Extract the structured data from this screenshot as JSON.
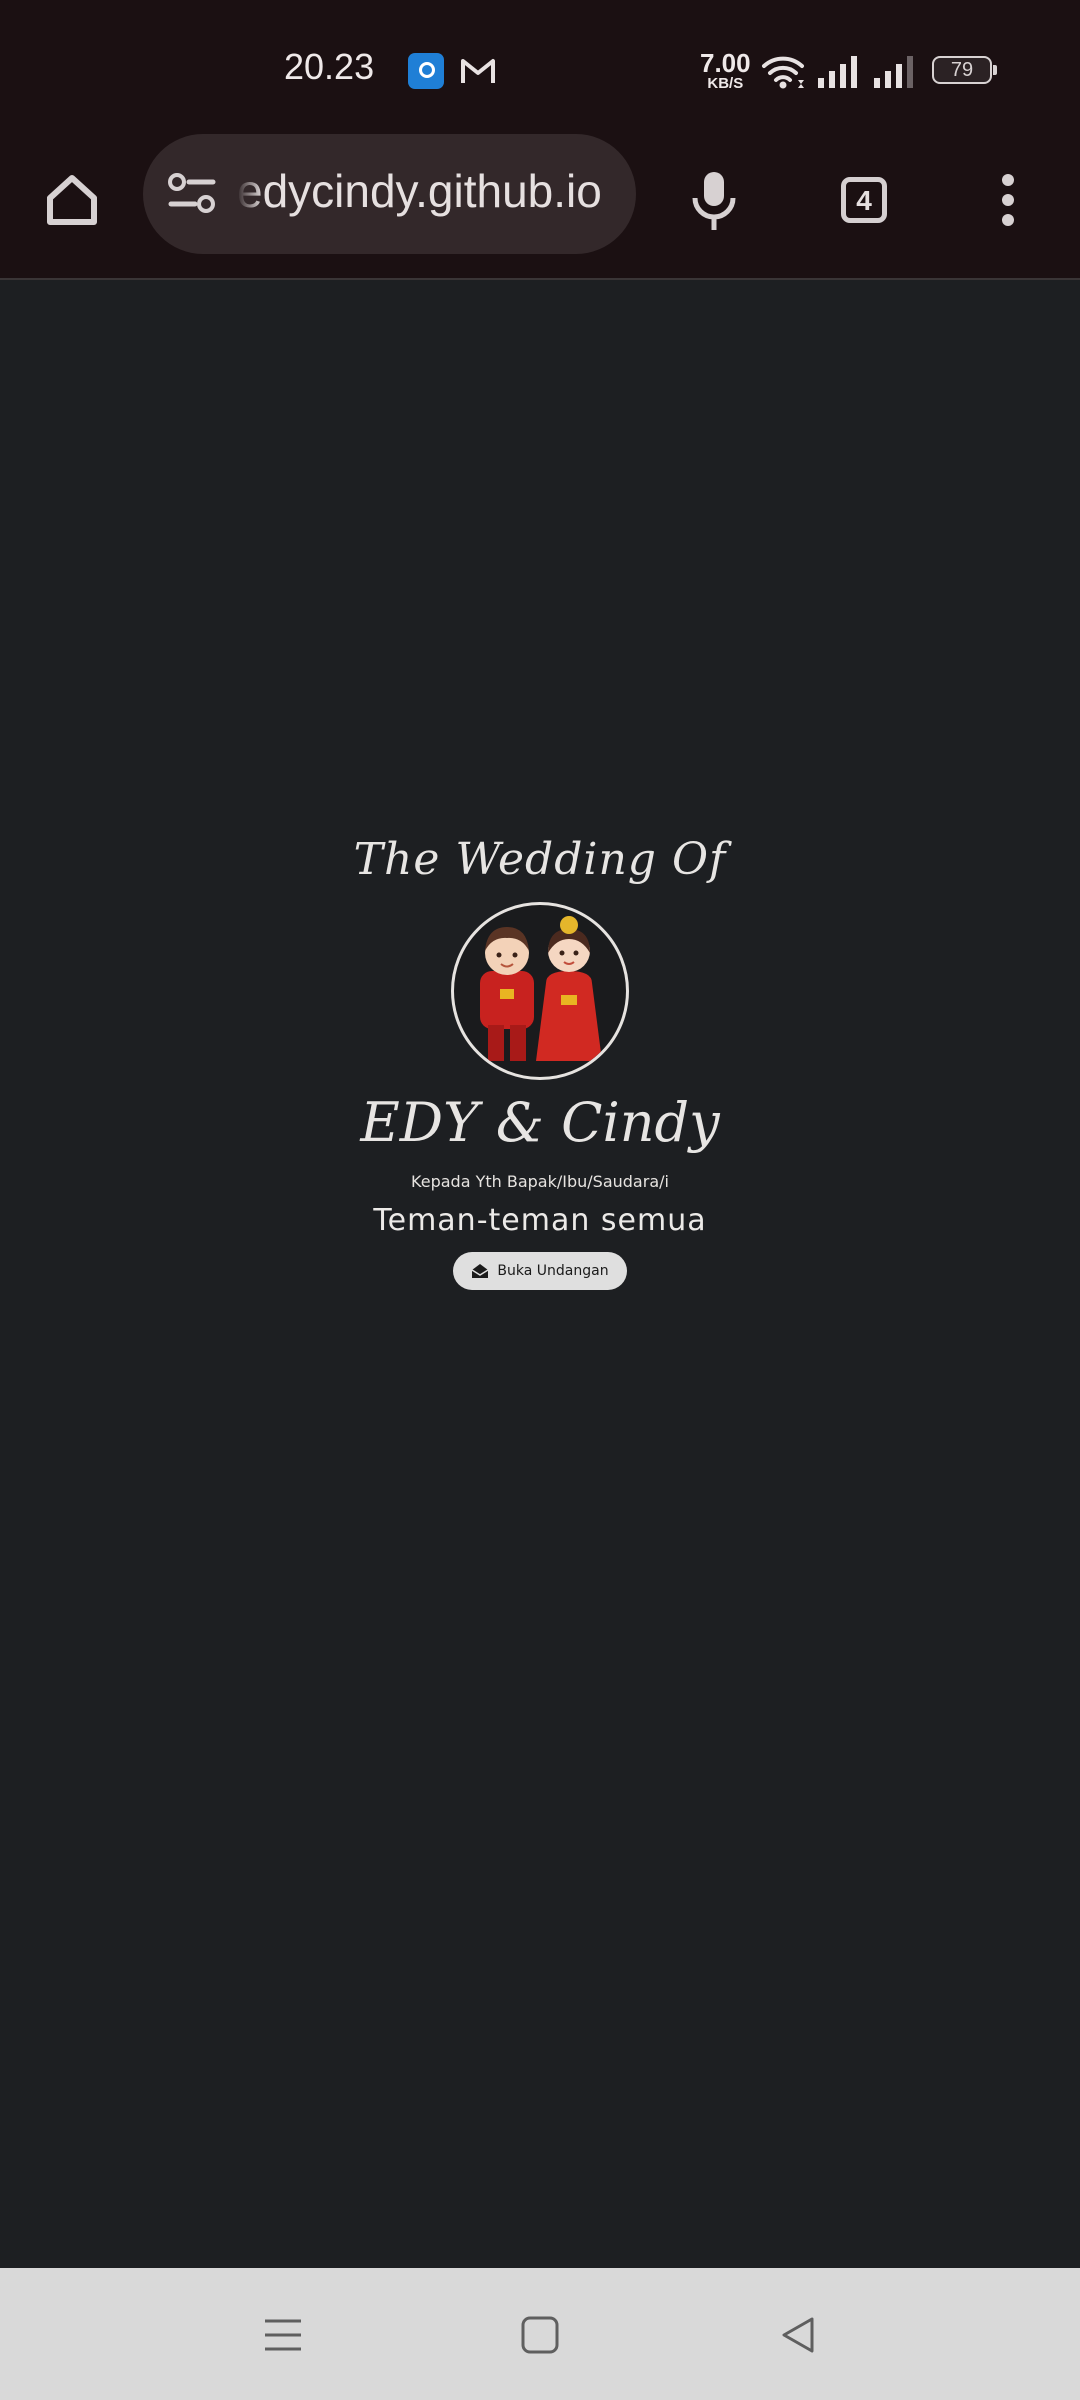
{
  "status_bar": {
    "time": "20.23",
    "net_speed_value": "7.00",
    "net_speed_unit": "KB/S",
    "battery_level": "79",
    "icons": [
      "app-notification-icon",
      "gmail-icon",
      "wifi-icon",
      "signal-icon",
      "signal-icon",
      "battery-icon"
    ]
  },
  "browser": {
    "url": "edycindy.github.io",
    "tab_count": "4",
    "icons": [
      "home-icon",
      "site-settings-icon",
      "mic-icon",
      "tabs-icon",
      "more-vert-icon"
    ]
  },
  "page": {
    "title": "The Wedding Of",
    "couple": "EDY & Cindy",
    "salutation": "Kepada Yth Bapak/Ibu/Saudara/i",
    "guest": "Teman-teman semua",
    "open_button": "Buka Undangan"
  },
  "navigation": {
    "icons": [
      "recents-icon",
      "home-square-icon",
      "back-icon"
    ]
  },
  "colors": {
    "status_bar_bg": "#1b1012",
    "page_bg": "#1d1f22",
    "url_bar_bg": "#33282a",
    "nav_bar_bg": "#d9d9d9",
    "button_bg": "#dfdfdf"
  }
}
